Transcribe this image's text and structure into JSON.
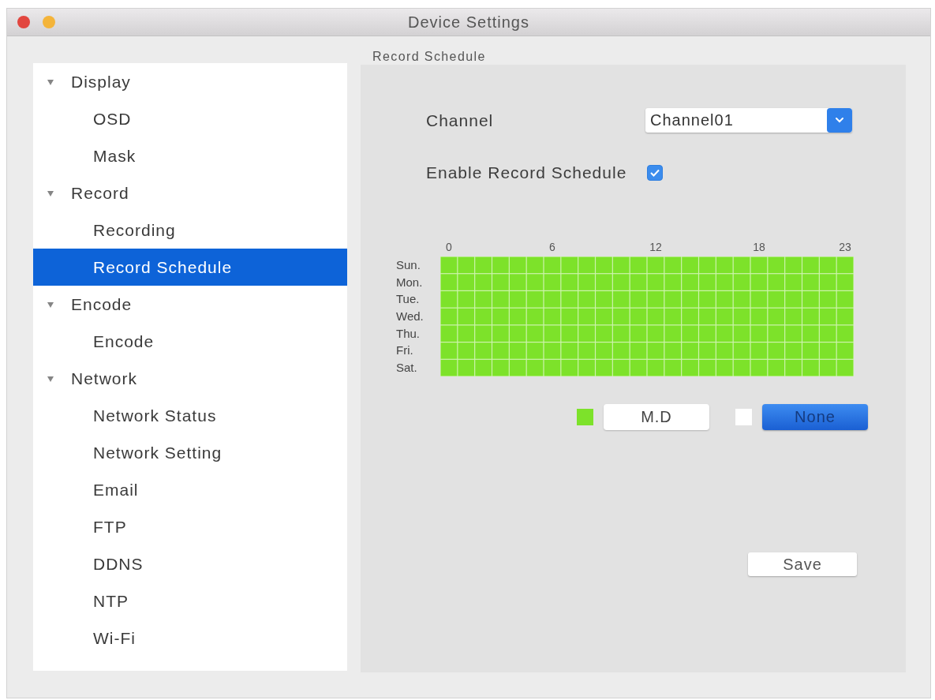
{
  "window": {
    "title": "Device Settings"
  },
  "sidebar": {
    "items": [
      {
        "label": "Display",
        "expanded": true,
        "selected": false,
        "children": [
          {
            "label": "OSD",
            "selected": false
          },
          {
            "label": "Mask",
            "selected": false
          }
        ]
      },
      {
        "label": "Record",
        "expanded": true,
        "selected": false,
        "children": [
          {
            "label": "Recording",
            "selected": false
          },
          {
            "label": "Record Schedule",
            "selected": true
          }
        ]
      },
      {
        "label": "Encode",
        "expanded": true,
        "selected": false,
        "children": [
          {
            "label": "Encode",
            "selected": false
          }
        ]
      },
      {
        "label": "Network",
        "expanded": true,
        "selected": false,
        "children": [
          {
            "label": "Network Status",
            "selected": false
          },
          {
            "label": "Network Setting",
            "selected": false
          },
          {
            "label": "Email",
            "selected": false
          },
          {
            "label": "FTP",
            "selected": false
          },
          {
            "label": "DDNS",
            "selected": false
          },
          {
            "label": "NTP",
            "selected": false
          },
          {
            "label": "Wi-Fi",
            "selected": false
          }
        ]
      }
    ]
  },
  "panel": {
    "title": "Record Schedule",
    "channel": {
      "label": "Channel",
      "value": "Channel01"
    },
    "enable_schedule": {
      "label": "Enable Record Schedule",
      "checked": true
    },
    "schedule": {
      "hour_labels": [
        "0",
        "6",
        "12",
        "18",
        "23"
      ],
      "days": [
        {
          "label": "Sun.",
          "slots": [
            true,
            true,
            true,
            true,
            true,
            true,
            true,
            true,
            true,
            true,
            true,
            true,
            true,
            true,
            true,
            true,
            true,
            true,
            true,
            true,
            true,
            true,
            true,
            true
          ]
        },
        {
          "label": "Mon.",
          "slots": [
            true,
            true,
            true,
            true,
            true,
            true,
            true,
            true,
            true,
            true,
            true,
            true,
            true,
            true,
            true,
            true,
            true,
            true,
            true,
            true,
            true,
            true,
            true,
            true
          ]
        },
        {
          "label": "Tue.",
          "slots": [
            true,
            true,
            true,
            true,
            true,
            true,
            true,
            true,
            true,
            true,
            true,
            true,
            true,
            true,
            true,
            true,
            true,
            true,
            true,
            true,
            true,
            true,
            true,
            true
          ]
        },
        {
          "label": "Wed.",
          "slots": [
            true,
            true,
            true,
            true,
            true,
            true,
            true,
            true,
            true,
            true,
            true,
            true,
            true,
            true,
            true,
            true,
            true,
            true,
            true,
            true,
            true,
            true,
            true,
            true
          ]
        },
        {
          "label": "Thu.",
          "slots": [
            true,
            true,
            true,
            true,
            true,
            true,
            true,
            true,
            true,
            true,
            true,
            true,
            true,
            true,
            true,
            true,
            true,
            true,
            true,
            true,
            true,
            true,
            true,
            true
          ]
        },
        {
          "label": "Fri.",
          "slots": [
            true,
            true,
            true,
            true,
            true,
            true,
            true,
            true,
            true,
            true,
            true,
            true,
            true,
            true,
            true,
            true,
            true,
            true,
            true,
            true,
            true,
            true,
            true,
            true
          ]
        },
        {
          "label": "Sat.",
          "slots": [
            true,
            true,
            true,
            true,
            true,
            true,
            true,
            true,
            true,
            true,
            true,
            true,
            true,
            true,
            true,
            true,
            true,
            true,
            true,
            true,
            true,
            true,
            true,
            true
          ]
        }
      ]
    },
    "legend": [
      {
        "label": "M.D",
        "color": "#7de22a",
        "selected": false
      },
      {
        "label": "None",
        "color": "#ffffff",
        "selected": true
      }
    ],
    "save_button": "Save"
  }
}
